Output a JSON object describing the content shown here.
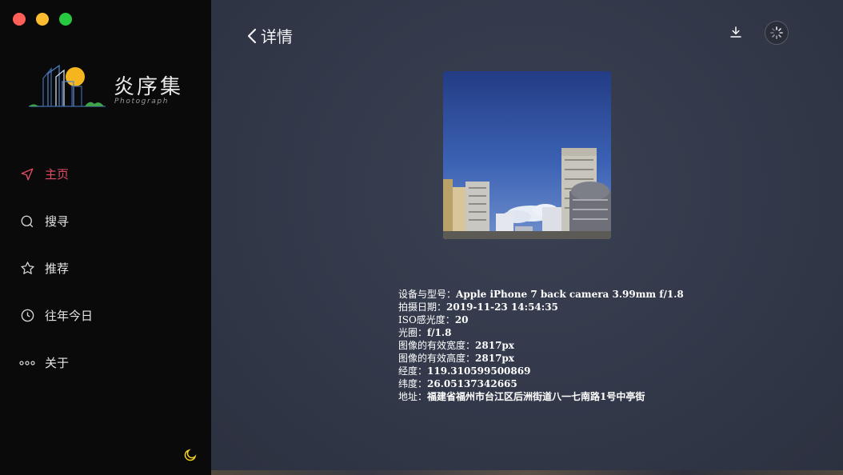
{
  "window": {
    "controls": [
      "close",
      "minimize",
      "maximize"
    ]
  },
  "brand": {
    "title": "炎序集",
    "subtitle": "Photograph"
  },
  "sidebar": {
    "items": [
      {
        "label": "主页",
        "icon": "navigation-arrow-icon",
        "active": true
      },
      {
        "label": "搜寻",
        "icon": "search-icon",
        "active": false
      },
      {
        "label": "推荐",
        "icon": "star-icon",
        "active": false
      },
      {
        "label": "往年今日",
        "icon": "clock-icon",
        "active": false
      },
      {
        "label": "关于",
        "icon": "more-dots-icon",
        "active": false
      }
    ],
    "theme_toggle_icon": "moon-icon"
  },
  "header": {
    "title": "详情",
    "back_icon": "chevron-left-icon",
    "download_icon": "download-icon",
    "loading_icon": "spinner-icon"
  },
  "details": {
    "rows": [
      {
        "label": "设备与型号：",
        "value": "Apple iPhone 7 back camera 3.99mm f/1.8"
      },
      {
        "label": "拍摄日期：",
        "value": "2019-11-23 14:54:35"
      },
      {
        "label": "ISO感光度：",
        "value": "20"
      },
      {
        "label": "光圈：",
        "value": "f/1.8"
      },
      {
        "label": "图像的有效宽度：",
        "value": "2817px"
      },
      {
        "label": "图像的有效高度：",
        "value": "2817px"
      },
      {
        "label": "经度：",
        "value": "119.310599500869"
      },
      {
        "label": "纬度：",
        "value": "26.05137342665"
      },
      {
        "label": "地址：",
        "value": "福建省福州市台江区后洲街道八一七南路1号中亭街"
      }
    ]
  },
  "colors": {
    "accent": "#e44b65",
    "moon": "#f5d020",
    "sidebar_bg": "#0a0a0b",
    "main_bg": "#343a4b"
  }
}
